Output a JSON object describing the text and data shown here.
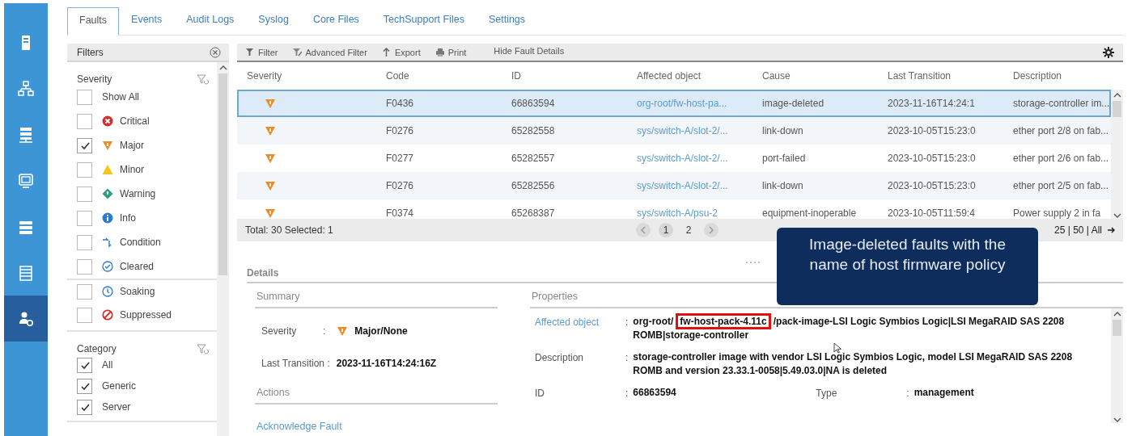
{
  "sidebar": {
    "items": [
      {
        "kind": "server",
        "selected": false
      },
      {
        "kind": "network",
        "selected": false
      },
      {
        "kind": "rack",
        "selected": false
      },
      {
        "kind": "monitor",
        "selected": false
      },
      {
        "kind": "storage",
        "selected": false
      },
      {
        "kind": "list",
        "selected": false
      },
      {
        "kind": "admin",
        "selected": true
      }
    ]
  },
  "tabs": [
    {
      "label": "Faults",
      "selected": true
    },
    {
      "label": "Events",
      "selected": false
    },
    {
      "label": "Audit Logs",
      "selected": false
    },
    {
      "label": "Syslog",
      "selected": false
    },
    {
      "label": "Core Files",
      "selected": false
    },
    {
      "label": "TechSupport Files",
      "selected": false
    },
    {
      "label": "Settings",
      "selected": false
    }
  ],
  "filters": {
    "title": "Filters",
    "groups": [
      {
        "title": "Severity",
        "items": [
          {
            "label": "Show All",
            "kind": "none",
            "checked": false
          },
          {
            "label": "Critical",
            "kind": "critical",
            "checked": false
          },
          {
            "label": "Major",
            "kind": "major",
            "checked": true
          },
          {
            "label": "Minor",
            "kind": "minor",
            "checked": false
          },
          {
            "label": "Warning",
            "kind": "warning",
            "checked": false
          },
          {
            "label": "Info",
            "kind": "info",
            "checked": false
          },
          {
            "label": "Condition",
            "kind": "condition",
            "checked": false
          },
          {
            "label": "Cleared",
            "kind": "cleared",
            "checked": false
          },
          {
            "label": "Soaking",
            "kind": "soaking",
            "checked": false
          },
          {
            "label": "Suppressed",
            "kind": "suppressed",
            "checked": false
          }
        ]
      },
      {
        "title": "Category",
        "items": [
          {
            "label": "All",
            "kind": "none",
            "checked": true
          },
          {
            "label": "Generic",
            "kind": "none",
            "checked": true
          },
          {
            "label": "Server",
            "kind": "none",
            "checked": true
          }
        ]
      }
    ]
  },
  "toolbar": [
    {
      "label": "Filter",
      "kind": "filter"
    },
    {
      "label": "Advanced Filter",
      "kind": "advanced"
    },
    {
      "label": "Export",
      "kind": "export"
    },
    {
      "label": "Print",
      "kind": "print"
    },
    {
      "label": "Hide Fault Details",
      "kind": "text"
    }
  ],
  "table": {
    "columns": [
      "Severity",
      "Code",
      "ID",
      "Affected object",
      "Cause",
      "Last Transition",
      "Description"
    ],
    "rows": [
      {
        "kind": "major",
        "selected": true,
        "cells": [
          "",
          "F0436",
          "66863594",
          "org-root/fw-host-pa...",
          "image-deleted",
          "2023-11-16T14:24:1",
          "storage-controller im..."
        ]
      },
      {
        "kind": "major",
        "selected": false,
        "cells": [
          "",
          "F0276",
          "65282558",
          "sys/switch-A/slot-2/...",
          "link-down",
          "2023-10-05T15:23:0",
          "ether port 2/8 on fab..."
        ]
      },
      {
        "kind": "major",
        "selected": false,
        "cells": [
          "",
          "F0277",
          "65282557",
          "sys/switch-A/slot-2/...",
          "port-failed",
          "2023-10-05T15:23:0",
          "ether port 2/6 on fab..."
        ]
      },
      {
        "kind": "major",
        "selected": false,
        "cells": [
          "",
          "F0276",
          "65282556",
          "sys/switch-A/slot-2/...",
          "link-down",
          "2023-10-05T15:23:0",
          "ether port 2/5 on fab..."
        ]
      },
      {
        "kind": "major",
        "selected": false,
        "cells": [
          "",
          "F0374",
          "65268387",
          "sys/switch-A/psu-2",
          "equipment-inoperable",
          "2023-10-05T11:59:4",
          "Power supply 2 in fa"
        ]
      }
    ],
    "total": "Total: 30 Selected: 1",
    "pages": [
      {
        "label": "1",
        "selected": true
      },
      {
        "label": "2",
        "selected": false
      }
    ],
    "page_sizes": "25 | 50 | All"
  },
  "details": {
    "title": "Details",
    "summary": {
      "title": "Summary",
      "fields": [
        {
          "label": "Severity",
          "separator": ":",
          "kind": "major",
          "value": "Major/None"
        },
        {
          "label": "Last Transition :",
          "kind": "none",
          "value": "2023-11-16T14:24:16Z"
        }
      ],
      "actions_title": "Actions",
      "actions": [
        "Acknowledge Fault"
      ]
    },
    "properties": {
      "title": "Properties",
      "fields": [
        {
          "label": "Affected object",
          "kind": "link",
          "separator": ":",
          "parts": [
            {
              "text": "org-root/",
              "highlighted": false
            },
            {
              "text": "fw-host-pack-4.11c",
              "highlighted": true
            },
            {
              "text": "/pack-image-LSI Logic Symbios Logic|LSI MegaRAID SAS 2208 ROMB|storage-controller",
              "highlighted": false
            }
          ]
        },
        {
          "label": "Description",
          "kind": "text",
          "separator": ":",
          "parts": [
            {
              "text": "storage-controller image with vendor LSI Logic Symbios Logic, model LSI MegaRAID SAS 2208 ROMB and version 23.33.1-0058|5.49.03.0|NA is deleted",
              "highlighted": false
            }
          ]
        },
        {
          "label": "ID",
          "kind": "text",
          "separator": ":",
          "parts": [
            {
              "text": "66863594",
              "highlighted": false
            }
          ],
          "pair": {
            "label": "Type",
            "separator": ":",
            "value": "management"
          }
        }
      ]
    }
  },
  "callout": "Image-deleted faults with the name of host firmware policy"
}
